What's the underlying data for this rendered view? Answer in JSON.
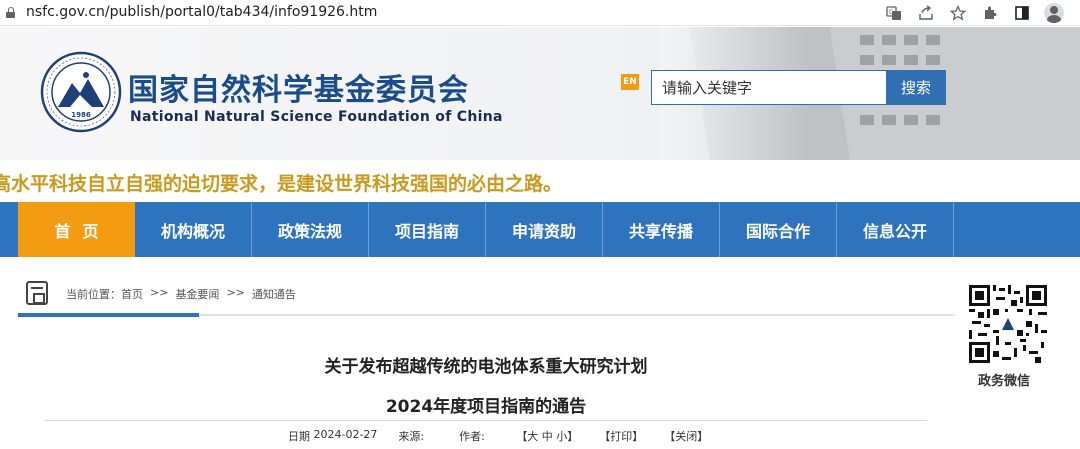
{
  "browser": {
    "url": "nsfc.gov.cn/publish/portal0/tab434/info91926.htm",
    "icons": [
      "translate-icon",
      "share-icon",
      "star-icon",
      "extensions-icon",
      "sidepanel-icon",
      "profile-icon"
    ]
  },
  "header": {
    "title": "国家自然科学基金委员会",
    "subtitle": "National Natural Science Foundation of China",
    "logo_year": "1986",
    "en_label": "EN",
    "search": {
      "placeholder": "请输入关键字",
      "button": "搜索"
    }
  },
  "marquee": "高水平科技自立自强的迫切要求，是建设世界科技强国的必由之路。",
  "nav": {
    "items": [
      "首页",
      "机构概况",
      "政策法规",
      "项目指南",
      "申请资助",
      "共享传播",
      "国际合作",
      "信息公开"
    ],
    "active_index": 0
  },
  "breadcrumb": {
    "prefix": "当前位置：",
    "items": [
      "首页",
      "基金要闻",
      "通知通告"
    ],
    "separator": ">>"
  },
  "qr": {
    "label": "政务微信"
  },
  "article": {
    "title_line1": "关于发布超越传统的电池体系重大研究计划",
    "title_line2": "2024年度项目指南的通告",
    "date_label": "日期",
    "date": "2024-02-27",
    "source_label": "来源:",
    "author_label": "作者:",
    "font_size": "【大 中 小】",
    "print": "【打印】",
    "close": "【关闭】"
  },
  "colors": {
    "nav_blue": "#2e73be",
    "active_orange": "#f39c12",
    "title_blue": "#1a4c8c",
    "marquee_gold": "#c99a1e"
  }
}
